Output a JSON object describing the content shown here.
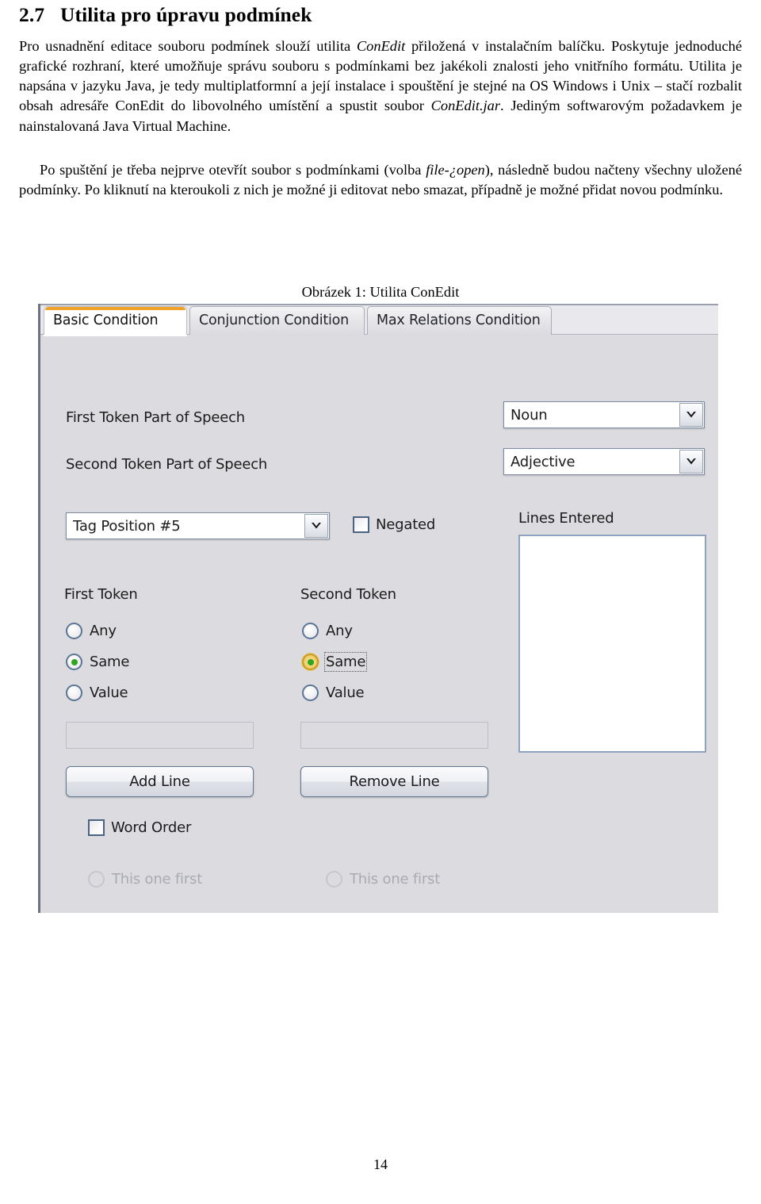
{
  "document": {
    "section_number": "2.7",
    "heading": "Utilita pro úpravu podmínek",
    "paragraph_1_a": "Pro usnadnění editace souboru podmínek slouží utilita ",
    "paragraph_1_em1": "ConEdit",
    "paragraph_1_b": " přiložená v instalačním balíčku. Poskytuje jednoduché grafické rozhraní, které umožňuje správu souboru s podmínkami bez jakékoli znalosti jeho vnitřního formátu. Utilita je napsána v jazyku Java, je tedy multiplatformní a její instalace i spouštění je stejné na OS Windows i Unix – stačí rozbalit obsah adresáře ConEdit do libovolného umístění a spustit soubor ",
    "paragraph_1_em2": "ConEdit.jar",
    "paragraph_1_c": ". Jediným softwarovým požadavkem je nainstalovaná Java Virtual Machine.",
    "paragraph_2_a": "Po spuštění je třeba nejprve otevřít soubor s podmínkami (volba ",
    "paragraph_2_em1": "file-¿open",
    "paragraph_2_b": "), následně budou načteny všechny uložené podmínky. Po kliknutí na kteroukoli z nich je možné ji editovat nebo smazat, případně je možné přidat novou podmínku.",
    "figure_caption": "Obrázek 1: Utilita ConEdit",
    "page_number": "14"
  },
  "app": {
    "tabs": [
      {
        "label": "Basic Condition",
        "active": true
      },
      {
        "label": "Conjunction Condition",
        "active": false
      },
      {
        "label": "Max Relations Condition",
        "active": false
      }
    ],
    "fields": {
      "first_pos_label": "First Token Part of Speech",
      "first_pos_value": "Noun",
      "second_pos_label": "Second Token Part of Speech",
      "second_pos_value": "Adjective",
      "tag_position_value": "Tag Position #5",
      "negated_label": "Negated",
      "negated_checked": false,
      "lines_entered_label": "Lines Entered",
      "lines_entered_items": []
    },
    "first_token": {
      "group_label": "First Token",
      "options": [
        "Any",
        "Same",
        "Value"
      ],
      "selected": "Same",
      "value_text": ""
    },
    "second_token": {
      "group_label": "Second Token",
      "options": [
        "Any",
        "Same",
        "Value"
      ],
      "selected": "Same",
      "focused": "Same",
      "value_text": ""
    },
    "buttons": {
      "add_line": "Add Line",
      "remove_line": "Remove Line"
    },
    "word_order": {
      "label": "Word Order",
      "checked": false,
      "first_option": "This one first",
      "second_option": "This one first",
      "enabled": false
    },
    "colors": {
      "active_tab_accent": "#f0a22b",
      "panel_background": "#dcdce0",
      "radio_selected_dot": "#2fa520",
      "focus_ring": "#d8ab3a",
      "control_border": "#7b8ba3"
    }
  }
}
